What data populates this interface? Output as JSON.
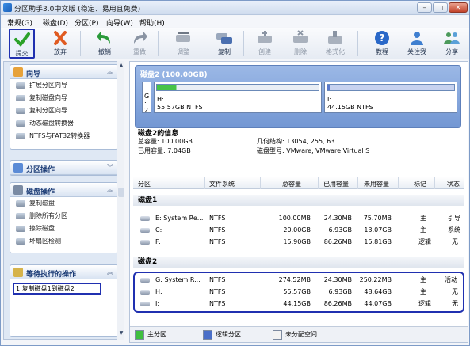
{
  "window": {
    "title": "分区助手3.0中文版 (稳定、易用且免费)",
    "min": "–",
    "max": "□",
    "close": "✕"
  },
  "menu": [
    "常规(G)",
    "磁盘(D)",
    "分区(P)",
    "向导(W)",
    "帮助(H)"
  ],
  "toolbar": [
    {
      "label": "提交",
      "icon": "check-icon",
      "color": "#2aa12a",
      "enabled": true
    },
    {
      "label": "放弃",
      "icon": "discard-x-icon",
      "color": "#e05b22",
      "enabled": true
    },
    {
      "label": "撤销",
      "icon": "undo-icon",
      "color": "#2a9a3a",
      "enabled": true
    },
    {
      "label": "重做",
      "icon": "redo-icon",
      "color": "#8a94a3",
      "enabled": false
    },
    {
      "label": "调整",
      "icon": "resize-disk-icon",
      "color": "#8a94a3",
      "enabled": false
    },
    {
      "label": "复制",
      "icon": "copy-disk-icon",
      "color": "#4a6fb0",
      "enabled": true
    },
    {
      "label": "创建",
      "icon": "create-disk-icon",
      "color": "#8a94a3",
      "enabled": false
    },
    {
      "label": "删除",
      "icon": "delete-disk-icon",
      "color": "#8a94a3",
      "enabled": false
    },
    {
      "label": "格式化",
      "icon": "format-disk-icon",
      "color": "#8a94a3",
      "enabled": false
    },
    {
      "label": "教程",
      "icon": "help-icon",
      "color": "#2a68c8",
      "enabled": true
    },
    {
      "label": "关注我",
      "icon": "follow-icon",
      "color": "#3f7fd0",
      "enabled": true
    },
    {
      "label": "分享",
      "icon": "share-icon",
      "color": "#4c9a5b",
      "enabled": true
    }
  ],
  "sidebar": {
    "wizard": {
      "title": "向导",
      "items": [
        "扩展分区向导",
        "复制磁盘向导",
        "复制分区向导",
        "动态磁盘转换器",
        "NTFS与FAT32转换器"
      ]
    },
    "partition_ops": {
      "title": "分区操作"
    },
    "disk_ops": {
      "title": "磁盘操作",
      "items": [
        "复制磁盘",
        "删除所有分区",
        "擦除磁盘",
        "坏扇区检测"
      ]
    },
    "pending": {
      "title": "等待执行的操作",
      "items": [
        "1.复制磁盘1到磁盘2"
      ]
    }
  },
  "disk_card": {
    "title": "磁盘2 (100.00GB)",
    "prefix": [
      "G",
      ":",
      "2"
    ],
    "partitions": [
      {
        "name": "H:",
        "size": "55.57GB NTFS",
        "used_fraction": 0.12
      },
      {
        "name": "I:",
        "size": "44.15GB NTFS",
        "used_fraction": 0.02
      }
    ]
  },
  "disk_info": {
    "title": "磁盘2的信息",
    "total_label": "总容量: 100.00GB",
    "used_label": "已用容量: 7.04GB",
    "geometry": "几何结构: 13054, 255, 63",
    "model": "磁盘型号: VMware, VMware Virtual S"
  },
  "table": {
    "headers": [
      "分区",
      "文件系统",
      "总容量",
      "已用容量",
      "未用容量",
      "标记",
      "状态"
    ],
    "disks": [
      {
        "name": "磁盘1",
        "rows": [
          [
            "E:  System Re...",
            "NTFS",
            "100.00MB",
            "24.30MB",
            "75.70MB",
            "主",
            "引导"
          ],
          [
            "C:",
            "NTFS",
            "20.00GB",
            "6.93GB",
            "13.07GB",
            "主",
            "系统"
          ],
          [
            "F:",
            "NTFS",
            "15.90GB",
            "86.26MB",
            "15.81GB",
            "逻辑",
            "无"
          ]
        ]
      },
      {
        "name": "磁盘2",
        "rows": [
          [
            "G:  System R...",
            "NTFS",
            "274.52MB",
            "24.30MB",
            "250.22MB",
            "主",
            "活动"
          ],
          [
            "H:",
            "NTFS",
            "55.57GB",
            "6.93GB",
            "48.64GB",
            "主",
            "无"
          ],
          [
            "I:",
            "NTFS",
            "44.15GB",
            "86.26MB",
            "44.07GB",
            "逻辑",
            "无"
          ]
        ]
      }
    ]
  },
  "legend": [
    {
      "label": "主分区",
      "color": "#3fbf3f"
    },
    {
      "label": "逻辑分区",
      "color": "#4a6fc8"
    },
    {
      "label": "未分配空间",
      "color": "#f2f2f2"
    }
  ]
}
